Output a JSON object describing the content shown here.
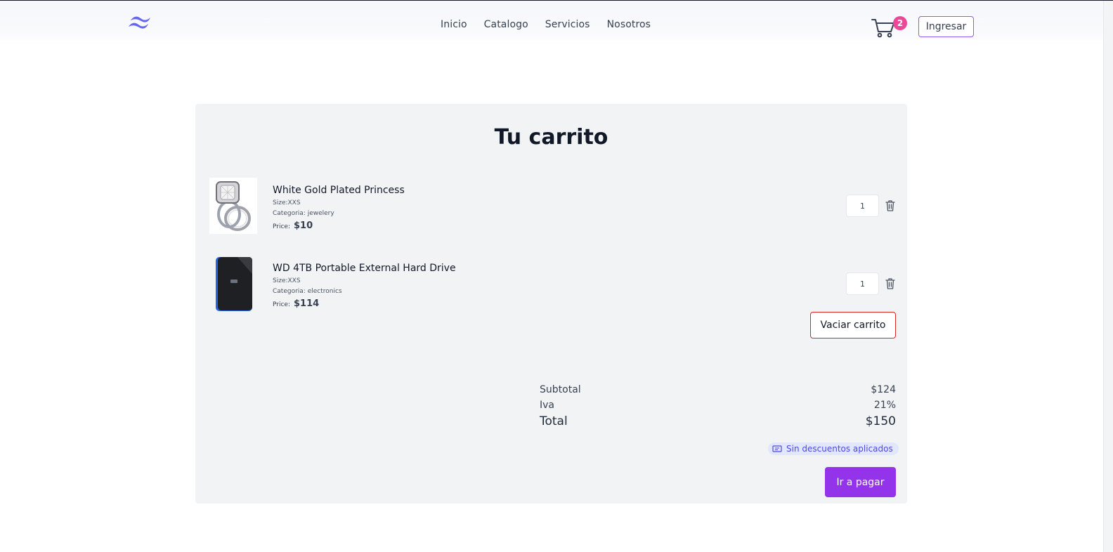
{
  "nav": {
    "links": [
      "Inicio",
      "Catalogo",
      "Servicios",
      "Nosotros"
    ],
    "cart_count": "2",
    "login_label": "Ingresar"
  },
  "cart": {
    "title": "Tu carrito",
    "items": [
      {
        "name": "White Gold Plated Princess",
        "size": "Size:XXS",
        "category": "Categoria: jewelery",
        "price_label": "Price:",
        "price": "$10",
        "quantity": "1",
        "image_icon": "ring-image"
      },
      {
        "name": "WD 4TB Portable External Hard Drive",
        "size": "Size:XXS",
        "category": "Categoria: electronics",
        "price_label": "Price:",
        "price": "$114",
        "quantity": "1",
        "image_icon": "hard-drive-image"
      }
    ],
    "empty_label": "Vaciar carrito",
    "summary": {
      "subtotal_label": "Subtotal",
      "subtotal": "$124",
      "iva_label": "Iva",
      "iva": "21%",
      "total_label": "Total",
      "total": "$150"
    },
    "discount_text": "Sin descuentos aplicados",
    "pay_label": "Ir a pagar"
  },
  "colors": {
    "accent": "#9333ea",
    "badge": "#ec4899",
    "danger": "#dc2626",
    "logo": "#6366f1"
  }
}
